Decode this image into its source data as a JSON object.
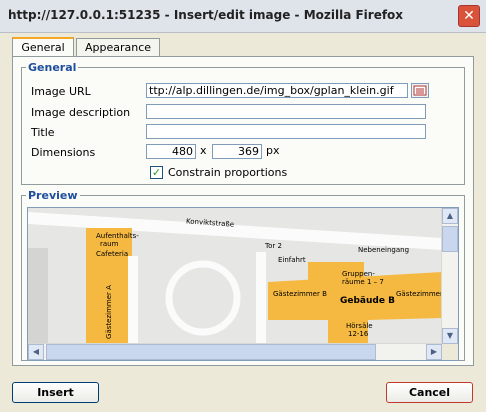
{
  "window": {
    "title": "http://127.0.0.1:51235 - Insert/edit image - Mozilla Firefox",
    "close_glyph": "✕"
  },
  "tabs": [
    {
      "label": "General"
    },
    {
      "label": "Appearance"
    }
  ],
  "general": {
    "legend": "General",
    "image_url": {
      "label": "Image URL",
      "value": "ttp://alp.dillingen.de/img_box/gplan_klein.gif"
    },
    "image_description": {
      "label": "Image description",
      "value": ""
    },
    "title_field": {
      "label": "Title",
      "value": ""
    },
    "dimensions": {
      "label": "Dimensions",
      "width": "480",
      "separator": "x",
      "height": "369",
      "unit": "px"
    },
    "constrain": {
      "label": "Constrain proportions",
      "checked": true
    }
  },
  "preview": {
    "legend": "Preview",
    "map_labels": {
      "konvikt": "Konviktstraße",
      "aufenthalt1": "Aufenthalts-",
      "aufenthalt2": "raum",
      "cafeteria": "Cafeteria",
      "tor": "Tor 2",
      "nebeneingang": "Nebeneingang",
      "einfahrt": "Einfahrt",
      "gruppen1": "Gruppen-",
      "gruppen2": "räume 1 – 7",
      "gast1": "Gästezimmer B",
      "gebaeude": "Gebäude B",
      "gast2": "Gästezimmer B",
      "gastA": "Gästezimmer A",
      "hoersaele1": "Hörsäle",
      "hoersaele2": "12-16"
    }
  },
  "buttons": {
    "insert": "Insert",
    "cancel": "Cancel"
  }
}
